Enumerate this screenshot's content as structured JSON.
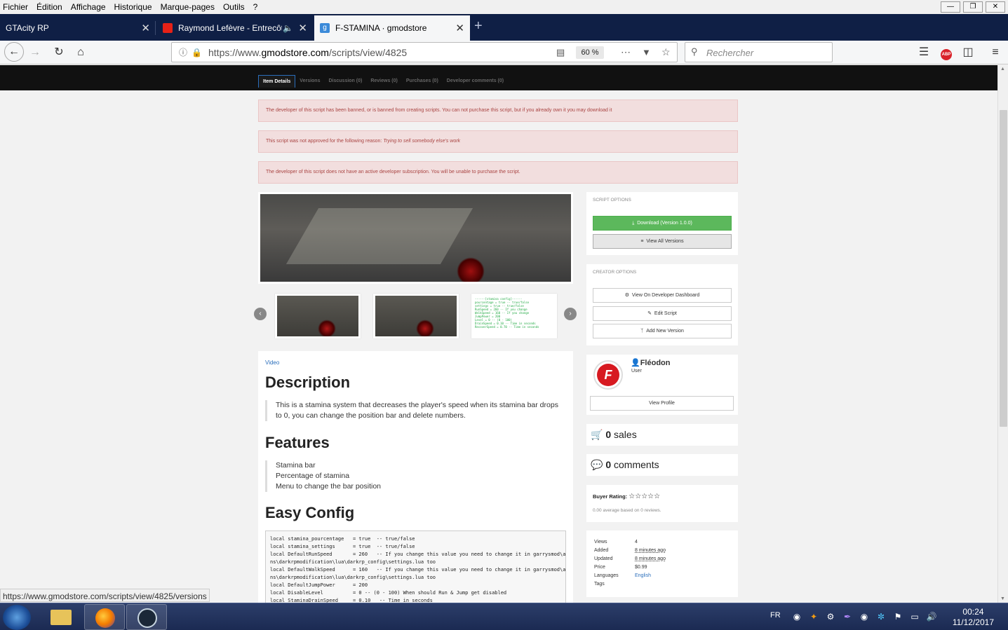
{
  "menu": [
    "Fichier",
    "Édition",
    "Affichage",
    "Historique",
    "Marque-pages",
    "Outils",
    "?"
  ],
  "tabs": [
    {
      "title": "GTAcity RP"
    },
    {
      "title": "Raymond Lefèvre - Entrecôt"
    },
    {
      "title": "F-STAMINA · gmodstore"
    }
  ],
  "nav": {
    "url_prefix": "https://www.",
    "url_host": "gmodstore.com",
    "url_path": "/scripts/view/4825",
    "zoom": "60 %",
    "search_placeholder": "Rechercher"
  },
  "subtabs": [
    "Item Details",
    "Versions",
    "Discussion (0)",
    "Reviews (0)",
    "Purchases (0)",
    "Developer comments (0)"
  ],
  "alerts": {
    "banned": "The developer of this script has been banned, or is banned from creating scripts. You can not purchase this script, but if you already own it you may download it",
    "not_approved_prefix": "This script was not approved for the following reason: ",
    "not_approved_reason": "Trying to sell somebody else's work",
    "subscription": "The developer of this script does not have an active developer subscription. You will be unable to purchase the script."
  },
  "content": {
    "video_link": "Video",
    "description_title": "Description",
    "description_text": "This is a stamina system that decreases the player's speed when its stamina bar drops to 0, you can change the position bar and delete numbers.",
    "features_title": "Features",
    "features": [
      "Stamina bar",
      "Percentage of stamina",
      "Menu to change the bar position"
    ],
    "config_title": "Easy Config",
    "code": "local stamina_pourcentage   = true  -- true/false\nlocal stamina_settings      = true  -- true/false\nlocal DefaultRunSpeed       = 260   -- If you change this value you need to change it in garrysmod\\addo\nns\\darkrpmodification\\lua\\darkrp_config\\settings.lua too\nlocal DefaultWalkSpeed      = 160   -- If you change this value you need to change it in garrysmod\\addo\nns\\darkrpmodification\\lua\\darkrp_config\\settings.lua too\nlocal DefaultJumpPower      = 200\nlocal DisableLevel          = 0 -- (0 - 100) When should Run & Jump get disabled\nlocal StaminaDrainSpeed     = 0.10   -- Time in seconds"
  },
  "script_options": {
    "header": "SCRIPT OPTIONS",
    "download": "Download (Version 1.0.0)",
    "view_versions": "View All Versions"
  },
  "creator_options": {
    "header": "CREATOR OPTIONS",
    "dashboard": "View On Developer Dashboard",
    "edit": "Edit Script",
    "add_version": "Add New Version"
  },
  "creator": {
    "name": "Fléodon",
    "role": "User",
    "view_profile": "View Profile"
  },
  "stats": {
    "sales_count": "0",
    "sales_label": "sales",
    "comments_count": "0",
    "comments_label": "comments",
    "buyer_rating_label": "Buyer Rating:",
    "rating_text": "0.00 average based on 0 reviews."
  },
  "info": [
    {
      "k": "Views",
      "v": "4"
    },
    {
      "k": "Added",
      "v": "8 minutes ago"
    },
    {
      "k": "Updated",
      "v": "8 minutes ago"
    },
    {
      "k": "Price",
      "v": "$0.99"
    },
    {
      "k": "Languages",
      "v": "English"
    },
    {
      "k": "Tags",
      "v": ""
    }
  ],
  "status_url": "https://www.gmodstore.com/scripts/view/4825/versions",
  "taskbar": {
    "lang": "FR",
    "time": "00:24",
    "date": "11/12/2017"
  },
  "colors": {
    "alert_bg": "#f2dede",
    "alert_text": "#a94442",
    "download_green": "#5cb85c",
    "link_blue": "#2a6ebb"
  }
}
